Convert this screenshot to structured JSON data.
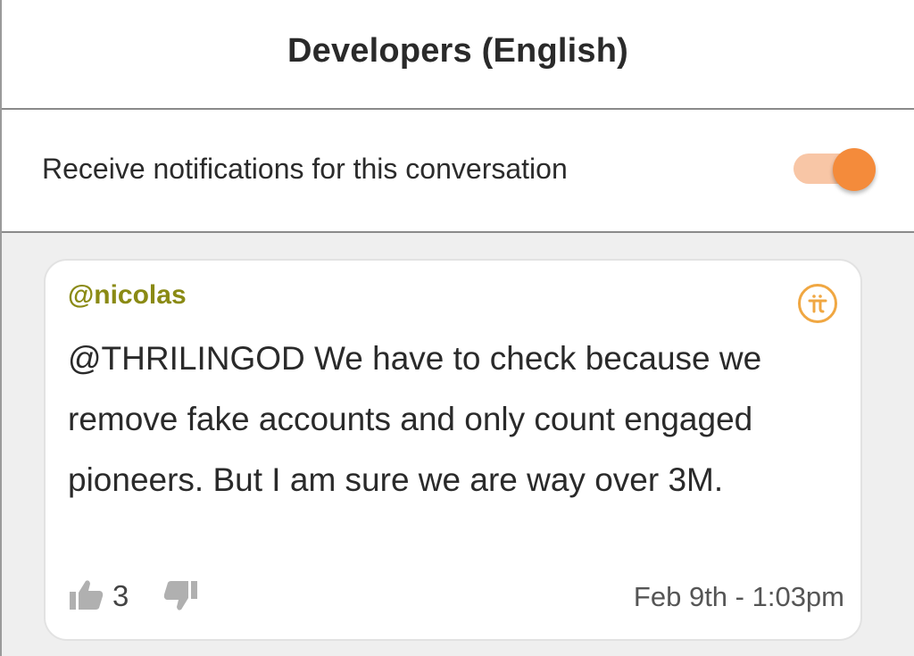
{
  "header": {
    "title": "Developers (English)"
  },
  "notifications": {
    "label": "Receive notifications for this conversation",
    "enabled": true,
    "accent_color": "#f48b3b"
  },
  "message": {
    "author": "@nicolas",
    "author_color": "#8a8a14",
    "badge_icon": "pi-logo-icon",
    "text": "@THRILINGOD We have to check because we remove fake accounts and only count engaged pioneers. But I am sure we are way over 3M.",
    "like_icon": "thumbs-up-icon",
    "like_count": "3",
    "dislike_icon": "thumbs-down-icon",
    "timestamp": "Feb 9th - 1:03pm"
  }
}
